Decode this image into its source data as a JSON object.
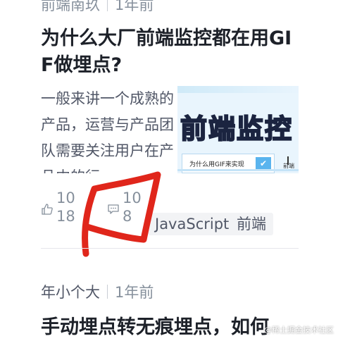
{
  "article1": {
    "author": "前端南玖",
    "time": "1年前",
    "title": "为什么大厂前端监控都在用GIF做埋点?",
    "abstract": "一般来讲一个成熟的产品，运营与产品团队需要关注用户在产品内的行",
    "thumbnail": {
      "big_text": "前端监控",
      "bar_text": "为什么用GIF来实现",
      "side_text": "前端"
    },
    "likes": "1018",
    "comments": "108",
    "tags": [
      "JavaScript",
      "前端"
    ]
  },
  "article2": {
    "author": "年小个大",
    "time": "1年前",
    "title": "手动埋点转无痕埋点，如何"
  },
  "watermark": "@稀土掘金技术社区",
  "colors": {
    "annotation": "#e0261b",
    "tag_bg": "#f2f3f5",
    "meta": "#86909c"
  }
}
